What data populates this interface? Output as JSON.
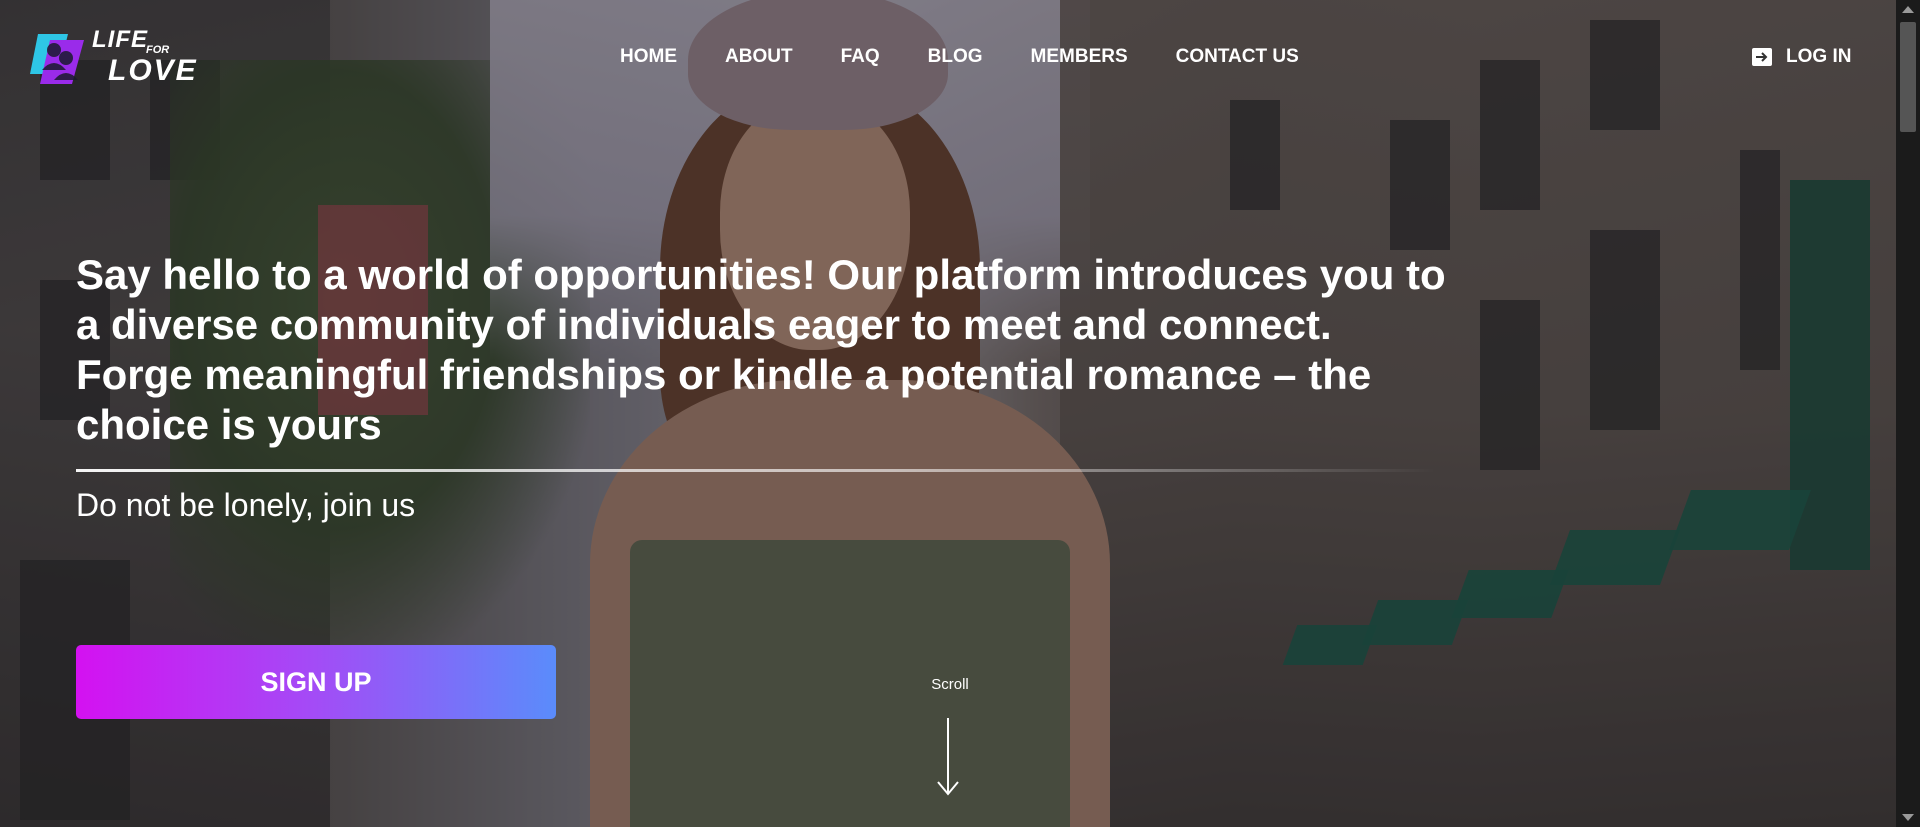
{
  "logo": {
    "line1": "LIFE",
    "line2": "FOR",
    "line3": "LOVE",
    "icon": "two-faces-logo-icon"
  },
  "nav": {
    "items": [
      {
        "label": "HOME"
      },
      {
        "label": "ABOUT"
      },
      {
        "label": "FAQ"
      },
      {
        "label": "BLOG"
      },
      {
        "label": "MEMBERS"
      },
      {
        "label": "CONTACT US"
      }
    ]
  },
  "login": {
    "label": "LOG IN",
    "icon": "login-arrow-icon"
  },
  "hero": {
    "headline": "Say hello to a world of opportunities! Our platform introduces you to a diverse community of individuals eager to meet and connect. Forge meaningful friendships or kindle a potential romance – the choice is yours",
    "tagline": "Do not be lonely, join us",
    "signup_label": "SIGN UP",
    "scroll_label": "Scroll"
  },
  "colors": {
    "signup_gradient_start": "#d411f1",
    "signup_gradient_end": "#5a8cfb",
    "logo_cyan": "#2ec6e6",
    "logo_purple": "#9a2bea"
  }
}
